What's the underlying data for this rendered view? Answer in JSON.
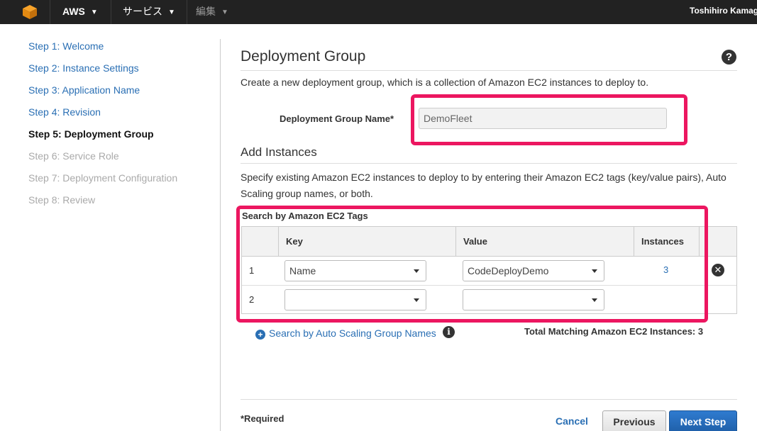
{
  "nav": {
    "aws_label": "AWS",
    "services_label": "サービス",
    "edit_label": "編集",
    "user_name": "Toshihiro Kamag"
  },
  "colors": {
    "link": "#2a6fb4",
    "highlight": "#ec1660",
    "primary_button": "#2f7bd0",
    "nav_background": "#222222",
    "logo": "#f7a32a"
  },
  "sidebar": {
    "steps": [
      {
        "label": "Step 1: Welcome",
        "state": "link"
      },
      {
        "label": "Step 2: Instance Settings",
        "state": "link"
      },
      {
        "label": "Step 3: Application Name",
        "state": "link"
      },
      {
        "label": "Step 4: Revision",
        "state": "link"
      },
      {
        "label": "Step 5: Deployment Group",
        "state": "current"
      },
      {
        "label": "Step 6: Service Role",
        "state": "disabled"
      },
      {
        "label": "Step 7: Deployment Configuration",
        "state": "disabled"
      },
      {
        "label": "Step 8: Review",
        "state": "disabled"
      }
    ]
  },
  "main": {
    "title": "Deployment Group",
    "help_icon": "?",
    "description": "Create a new deployment group, which is a collection of Amazon EC2 instances to deploy to.",
    "group_name_label": "Deployment Group Name*",
    "group_name_value": "DemoFleet",
    "add_instances_title": "Add Instances",
    "add_instances_desc": "Specify existing Amazon EC2 instances to deploy to by entering their Amazon EC2 tags (key/value pairs), Auto Scaling group names, or both.",
    "tags_title": "Search by Amazon EC2 Tags",
    "table": {
      "headers": {
        "key": "Key",
        "value": "Value",
        "instances": "Instances"
      },
      "rows": [
        {
          "num": "1",
          "key": "Name",
          "value": "CodeDeployDemo",
          "instances": "3"
        },
        {
          "num": "2",
          "key": "",
          "value": "",
          "instances": ""
        }
      ]
    },
    "asg_link": "Search by Auto Scaling Group Names",
    "total_matching": "Total Matching Amazon EC2 Instances: 3",
    "required_note": "*Required"
  },
  "footer": {
    "cancel": "Cancel",
    "previous": "Previous",
    "next": "Next Step"
  }
}
